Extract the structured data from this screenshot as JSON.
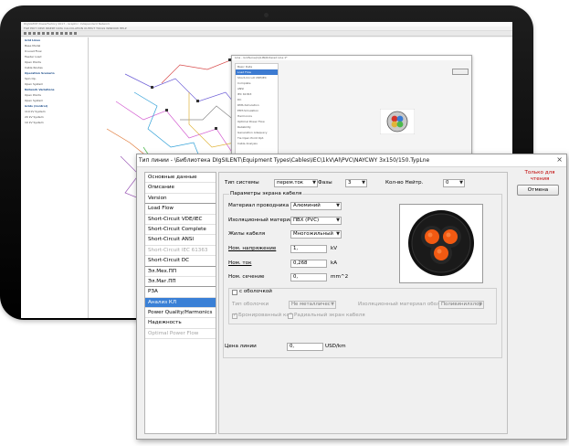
{
  "background_app": {
    "title": "DIgSILENT PowerFactory 2017 - Graphic: Independent Network",
    "menu": "FILE  EDIT  VIEW  INSERT  DATA  CALCULATION  OUTPUT  TOOLS  WINDOW  HELP",
    "tree": [
      {
        "label": "Grid Lines",
        "group": true
      },
      {
        "label": "Base Model",
        "group": false
      },
      {
        "label": "O-Load Flow",
        "group": false
      },
      {
        "label": "Feeder Load",
        "group": false
      },
      {
        "label": "Open Points",
        "group": false
      },
      {
        "label": "Cable Routes",
        "group": false
      },
      {
        "label": "Operation Scenario",
        "group": true
      },
      {
        "label": "Spin Op.",
        "group": false
      },
      {
        "label": "Open System",
        "group": false
      },
      {
        "label": "Network Variations",
        "group": true
      },
      {
        "label": "Open Points",
        "group": false
      },
      {
        "label": "Open System",
        "group": false
      },
      {
        "label": "Grids (Control)",
        "group": true
      },
      {
        "label": "110 kV System",
        "group": false
      },
      {
        "label": "20 kV System",
        "group": false
      },
      {
        "label": "10 kV System",
        "group": false
      }
    ],
    "bg_dialog": {
      "title": "Line - Grid\\Line(1)\\LIN\\Ordered Line 1*",
      "ok": "OK",
      "items": [
        "Basic Data",
        "Load Flow",
        "Short-Circuit VDE/IEC",
        "Complete",
        "ANSI",
        "IEC 61363",
        "DC",
        "RMS-Simulation",
        "EMT-Simulation",
        "Harmonics",
        "Optimal Power Flow",
        "Reliability",
        "Generation Adequacy",
        "Tie Open Point Opt.",
        "Cable Analysis"
      ]
    }
  },
  "dialog": {
    "title": "Тип линии - \\Библиотека DIgSILENT\\Equipment Types\\Cables\\IEC\\1kV\\Al\\PVC\\NAYCWY 3x150/150.TypLne",
    "close": "×",
    "read_only": "Только для чтения",
    "cancel": "Отмена",
    "nav": [
      {
        "label": "Основные данные",
        "state": "normal",
        "sep": false
      },
      {
        "label": "Описание",
        "state": "normal",
        "sep": false
      },
      {
        "label": "Version",
        "state": "normal",
        "sep": true
      },
      {
        "label": "Load Flow",
        "state": "normal",
        "sep": false
      },
      {
        "label": "Short-Circuit VDE/IEC",
        "state": "normal",
        "sep": false
      },
      {
        "label": "Short-Circuit Complete",
        "state": "normal",
        "sep": false
      },
      {
        "label": "Short-Circuit ANSI",
        "state": "normal",
        "sep": false
      },
      {
        "label": "Short-Circuit IEC 61363",
        "state": "disabled",
        "sep": false
      },
      {
        "label": "Short-Circuit DC",
        "state": "normal",
        "sep": true
      },
      {
        "label": "Эл.Мех.ПП",
        "state": "normal",
        "sep": false
      },
      {
        "label": "Эл.Маг.ПП",
        "state": "normal",
        "sep": true
      },
      {
        "label": "РЗА",
        "state": "normal",
        "sep": false
      },
      {
        "label": "Анализ КЛ",
        "state": "active",
        "sep": false
      },
      {
        "label": "Power Quality/Harmonics",
        "state": "normal",
        "sep": false
      },
      {
        "label": "Надежность",
        "state": "normal",
        "sep": false
      },
      {
        "label": "Optimal Power Flow",
        "state": "disabled",
        "sep": false
      }
    ],
    "system_type": {
      "label": "Тип системы",
      "value": "перем.ток"
    },
    "phases": {
      "label": "Фазы",
      "value": "3"
    },
    "neutrals": {
      "label": "Кол-во Нейтр.",
      "value": "0"
    },
    "shield_params": "Параметры экрана кабеля",
    "conductor_material": {
      "label": "Материал проводника",
      "value": "Алюминий"
    },
    "insulation_material": {
      "label": "Изоляционный материал",
      "value": "ПВХ (PVC)"
    },
    "cable_cores": {
      "label": "Жилы кабеля",
      "value": "Многожильный"
    },
    "rated_voltage": {
      "label": "Ном. напряжение",
      "value": "1,",
      "unit": "kV"
    },
    "rated_current": {
      "label": "Ном. ток",
      "value": "0,268",
      "unit": "kA"
    },
    "rated_section": {
      "label": "Ном. сечение",
      "value": "0,",
      "unit": "mm^2"
    },
    "sheath": {
      "checkbox_label": "с оболочкой",
      "sheath_type_label": "Тип оболочки",
      "sheath_type_value": "Не металличес",
      "insulation_label": "Изоляционный материал оболо",
      "insulation_value": "Поливинилхлор",
      "armored_label": "Бронированный каб",
      "radial_label": "Радиальный экран кабеля"
    },
    "line_price": {
      "label": "Цена линии",
      "value": "0,",
      "unit": "USD/km"
    }
  }
}
